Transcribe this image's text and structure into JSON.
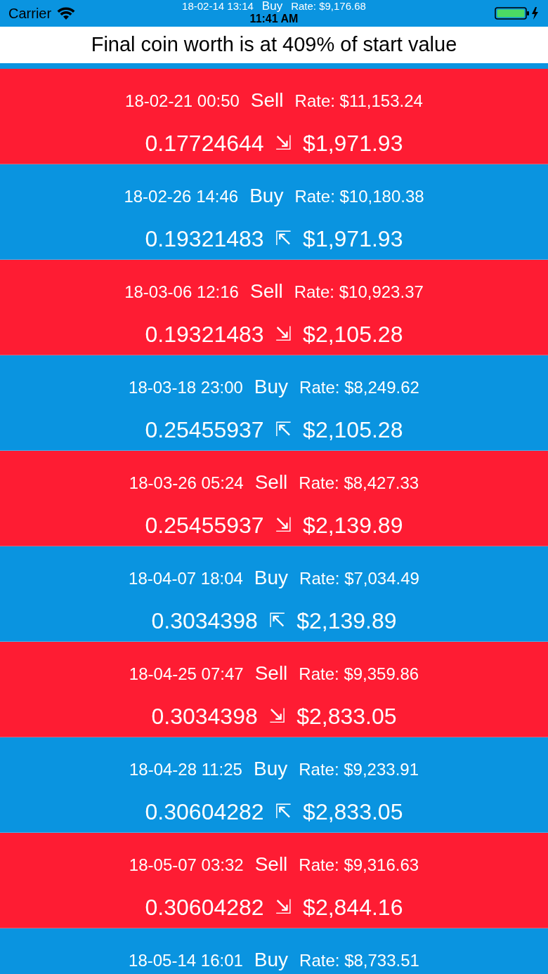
{
  "status_bar": {
    "carrier": "Carrier",
    "time": "11:41 AM"
  },
  "partial_trade": {
    "kind": "buy",
    "date": "18-02-14 13:14",
    "action": "Buy",
    "rate": "Rate: $9,176.68"
  },
  "summary": "Final coin worth is at 409% of start value",
  "trades": [
    {
      "kind": "sell",
      "date": "18-02-21 00:50",
      "action": "Sell",
      "rate": "Rate: $11,153.24",
      "coins": "0.17724644",
      "arrow": "⇲",
      "value": "$1,971.93"
    },
    {
      "kind": "buy",
      "date": "18-02-26 14:46",
      "action": "Buy",
      "rate": "Rate: $10,180.38",
      "coins": "0.19321483",
      "arrow": "⇱",
      "value": "$1,971.93"
    },
    {
      "kind": "sell",
      "date": "18-03-06 12:16",
      "action": "Sell",
      "rate": "Rate: $10,923.37",
      "coins": "0.19321483",
      "arrow": "⇲",
      "value": "$2,105.28"
    },
    {
      "kind": "buy",
      "date": "18-03-18 23:00",
      "action": "Buy",
      "rate": "Rate: $8,249.62",
      "coins": "0.25455937",
      "arrow": "⇱",
      "value": "$2,105.28"
    },
    {
      "kind": "sell",
      "date": "18-03-26 05:24",
      "action": "Sell",
      "rate": "Rate: $8,427.33",
      "coins": "0.25455937",
      "arrow": "⇲",
      "value": "$2,139.89"
    },
    {
      "kind": "buy",
      "date": "18-04-07 18:04",
      "action": "Buy",
      "rate": "Rate: $7,034.49",
      "coins": "0.3034398",
      "arrow": "⇱",
      "value": "$2,139.89"
    },
    {
      "kind": "sell",
      "date": "18-04-25 07:47",
      "action": "Sell",
      "rate": "Rate: $9,359.86",
      "coins": "0.3034398",
      "arrow": "⇲",
      "value": "$2,833.05"
    },
    {
      "kind": "buy",
      "date": "18-04-28 11:25",
      "action": "Buy",
      "rate": "Rate: $9,233.91",
      "coins": "0.30604282",
      "arrow": "⇱",
      "value": "$2,833.05"
    },
    {
      "kind": "sell",
      "date": "18-05-07 03:32",
      "action": "Sell",
      "rate": "Rate: $9,316.63",
      "coins": "0.30604282",
      "arrow": "⇲",
      "value": "$2,844.16"
    },
    {
      "kind": "buy",
      "date": "18-05-14 16:01",
      "action": "Buy",
      "rate": "Rate: $8,733.51"
    }
  ]
}
